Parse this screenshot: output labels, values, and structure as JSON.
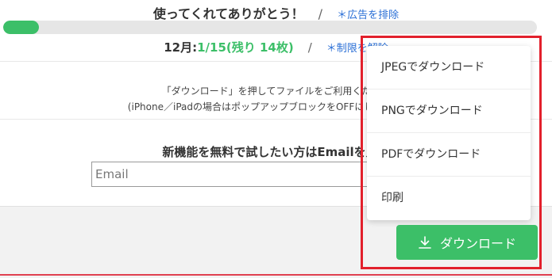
{
  "header": {
    "thanks": "使ってくれてありがとう！",
    "separator": "/",
    "remove_ads_link": "＊広告を排除"
  },
  "progress": {
    "value_fraction": 0.067,
    "color": "#3cbf68"
  },
  "limit": {
    "month": "12月",
    "colon": ":",
    "count_text": "1/15(残り 14枚)",
    "separator": "/",
    "link": "＊制限を解除"
  },
  "info": {
    "line1": "「ダウンロード」を押してファイルをご利用ください",
    "line2": "(iPhone／iPadの場合はポップアップブロックをOFFにしてください)"
  },
  "newfeature": {
    "text": "新機能を無料で試したい方はEmailを入力"
  },
  "email": {
    "placeholder": "Email"
  },
  "menu": {
    "items": [
      {
        "label": "JPEGでダウンロード"
      },
      {
        "label": "PNGでダウンロード"
      },
      {
        "label": "PDFでダウンロード"
      },
      {
        "label": "印刷"
      }
    ]
  },
  "download": {
    "label": "ダウンロード",
    "icon": "download-icon"
  },
  "colors": {
    "accent_green": "#3cbf68",
    "highlight_red": "#e2202c",
    "link_blue": "#2a6fd6"
  }
}
